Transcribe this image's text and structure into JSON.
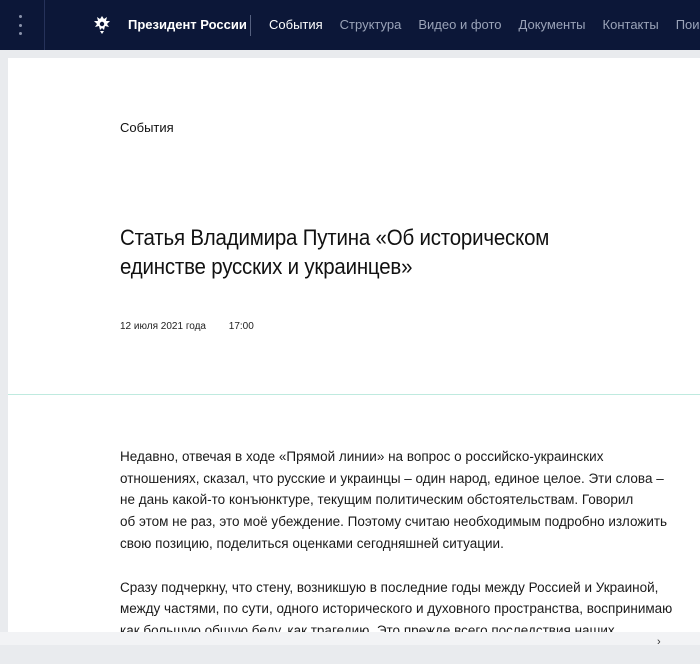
{
  "header": {
    "brand": "Президент России",
    "nav": [
      {
        "label": "События"
      },
      {
        "label": "Структура"
      },
      {
        "label": "Видео и фото"
      },
      {
        "label": "Документы"
      },
      {
        "label": "Контакты"
      },
      {
        "label": "Поиск"
      }
    ],
    "active_nav": "События"
  },
  "article": {
    "category": "События",
    "title_line1": "Статья Владимира Путина «Об историческом",
    "title_line2": "единстве русских и украинцев»",
    "date": "12 июля 2021 года",
    "time": "17:00",
    "paragraph1": [
      "Недавно, отвечая в ходе «Прямой линии» на вопрос о российско-украинских",
      "отношениях, сказал, что русские и украинцы – один народ, единое целое. Эти слова –",
      "не дань какой-то конъюнктуре, текущим политическим обстоятельствам. Говорил",
      "об этом не раз, это моё убеждение. Поэтому считаю необходимым подробно изложить",
      "свою позицию, поделиться оценками сегодняшней ситуации."
    ],
    "paragraph2": [
      "Сразу подчеркну, что стену, возникшую в последние годы между Россией и Украиной,",
      "между частями, по сути, одного исторического и духовного пространства, воспринимаю",
      "как большую общую беду, как трагедию. Это прежде всего последствия наших"
    ]
  },
  "colors": {
    "header_bg": "#0c1738",
    "divider": "#bfeadf"
  }
}
